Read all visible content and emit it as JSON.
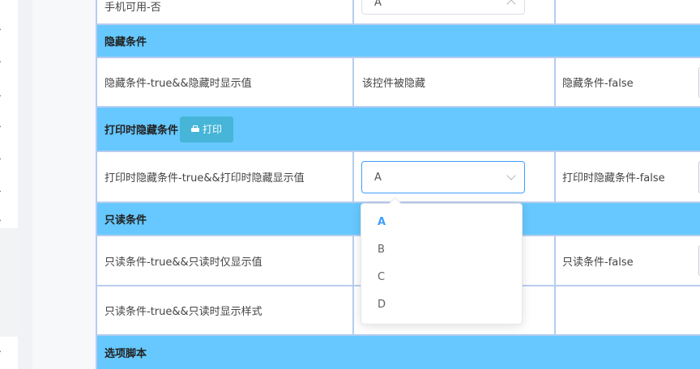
{
  "sections": {
    "hidden": "隐藏条件",
    "print_hidden": "打印时隐藏条件",
    "readonly": "只读条件",
    "option_script": "选项脚本"
  },
  "rows": {
    "top_partial": {
      "label": "手机可用-否",
      "select_value": "A"
    },
    "hidden_row": {
      "label": "隐藏条件-true&&隐藏时显示值",
      "value": "该控件被隐藏",
      "right": "隐藏条件-false"
    },
    "print_row": {
      "label": "打印时隐藏条件-true&&打印时隐藏显示值",
      "select_value": "A",
      "right": "打印时隐藏条件-false"
    },
    "readonly_row1": {
      "label": "只读条件-true&&只读时仅显示值",
      "right": "只读条件-false"
    },
    "readonly_row2": {
      "label": "只读条件-true&&只读时显示样式"
    }
  },
  "print_button": {
    "label": "打印",
    "icon": "printer-icon"
  },
  "dropdown": {
    "options": [
      "A",
      "B",
      "C",
      "D"
    ],
    "selected": "A"
  },
  "colors": {
    "section_bg": "#66c8fe",
    "border": "#b6cdee",
    "accent": "#409eff",
    "button": "#46b5d8"
  }
}
